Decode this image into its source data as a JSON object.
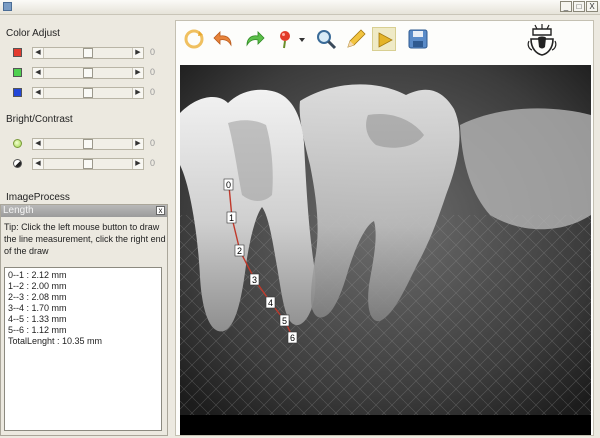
{
  "window": {
    "controls": {
      "minimize": "_",
      "maximize": "□",
      "close": "X"
    }
  },
  "color_adjust": {
    "title": "Color Adjust",
    "sliders": [
      {
        "channel": "red",
        "value": "0",
        "level": 0.5
      },
      {
        "channel": "green",
        "value": "0",
        "level": 0.5
      },
      {
        "channel": "blue",
        "value": "0",
        "level": 0.5
      }
    ]
  },
  "bright_contrast": {
    "title": "Bright/Contrast",
    "sliders": [
      {
        "name": "brightness",
        "value": "0",
        "level": 0.5
      },
      {
        "name": "contrast",
        "value": "0",
        "level": 0.5
      }
    ]
  },
  "image_process": {
    "title": "ImageProcess"
  },
  "length_panel": {
    "title": "Length",
    "close_label": "x",
    "tip": "Tip: Click the left mouse button to draw the line measurement, click the right end of the draw",
    "measurements": [
      "0--1 : 2.12 mm",
      "1--2 : 2.00 mm",
      "2--3 : 2.08 mm",
      "3--4 : 1.70 mm",
      "4--5 : 1.33 mm",
      "5--6 : 1.12 mm",
      "TotalLenght : 10.35 mm"
    ]
  },
  "toolbar": {
    "tools": [
      "refresh-icon",
      "undo-icon",
      "redo-icon",
      "pin-icon",
      "dropdown-icon",
      "magnifier-icon",
      "pencil-icon",
      "play-icon",
      "save-icon"
    ],
    "active_tool": "play-icon"
  },
  "measurement_points": {
    "labels": [
      "0",
      "1",
      "2",
      "3",
      "4",
      "5",
      "6"
    ]
  },
  "colors": {
    "measure_line": "#c0392b",
    "panel_bg": "#ece9e0",
    "length_header": "#a8a8a8"
  }
}
